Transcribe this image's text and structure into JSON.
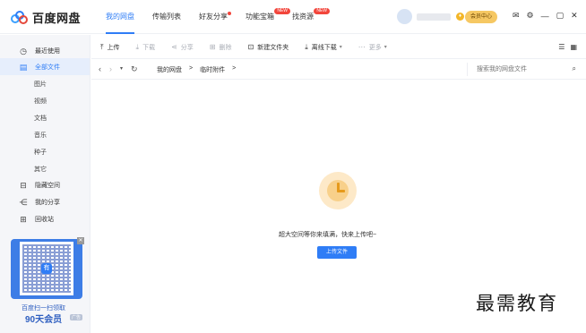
{
  "app": {
    "name": "百度网盘"
  },
  "topnav": [
    {
      "label": "我的网盘",
      "active": true,
      "badge": ""
    },
    {
      "label": "传输列表",
      "active": false,
      "badge": ""
    },
    {
      "label": "好友分享",
      "active": false,
      "badge": "dot"
    },
    {
      "label": "功能宝箱",
      "active": false,
      "badge": "NEW"
    },
    {
      "label": "找资源",
      "active": false,
      "badge": "NEW"
    }
  ],
  "user": {
    "vip_button": "会员中心"
  },
  "sidebar": {
    "items": [
      {
        "label": "最近使用",
        "icon": "clock-icon",
        "glyph": "◷"
      },
      {
        "label": "全部文件",
        "icon": "file-icon",
        "glyph": "▤"
      }
    ],
    "subitems": [
      "图片",
      "视频",
      "文档",
      "音乐",
      "种子",
      "其它"
    ],
    "bottom_items": [
      {
        "label": "隐藏空间",
        "icon": "lock-icon",
        "glyph": "🔒"
      },
      {
        "label": "我的分享",
        "icon": "share-icon",
        "glyph": "⋖"
      },
      {
        "label": "回收站",
        "icon": "trash-icon",
        "glyph": "🗑"
      }
    ]
  },
  "promo": {
    "qr_center": "有",
    "line1": "百度扫一扫领取",
    "line2": "90天会员",
    "tag": "广告"
  },
  "toolbar": {
    "upload": "上传",
    "download": "下载",
    "share": "分享",
    "delete": "删除",
    "new_folder": "新建文件夹",
    "offline_download": "离线下载",
    "more": "更多"
  },
  "breadcrumb": {
    "root": "我的网盘",
    "current": "临时附件",
    "sep": ">"
  },
  "search": {
    "placeholder": "搜索我的网盘文件"
  },
  "empty": {
    "message": "超大空间等你来填满，快来上传吧~",
    "upload_button": "上传文件"
  },
  "watermark": "最需教育",
  "colors": {
    "accent": "#2f7df6",
    "vip": "#f6c863",
    "badge": "#f2453b"
  }
}
